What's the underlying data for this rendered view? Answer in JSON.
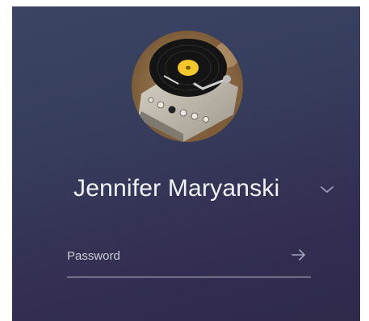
{
  "user": {
    "name": "Jennifer Maryanski",
    "avatar_icon": "record-player-avatar"
  },
  "password": {
    "placeholder": "Password",
    "value": ""
  },
  "icons": {
    "switch_user": "chevron-down-icon",
    "submit": "arrow-right-icon"
  },
  "colors": {
    "background": "#363e5c",
    "text": "#f1f2f6",
    "muted": "#c9ccd9",
    "underline": "#b8bccc",
    "label_yellow": "#f4c72b"
  }
}
